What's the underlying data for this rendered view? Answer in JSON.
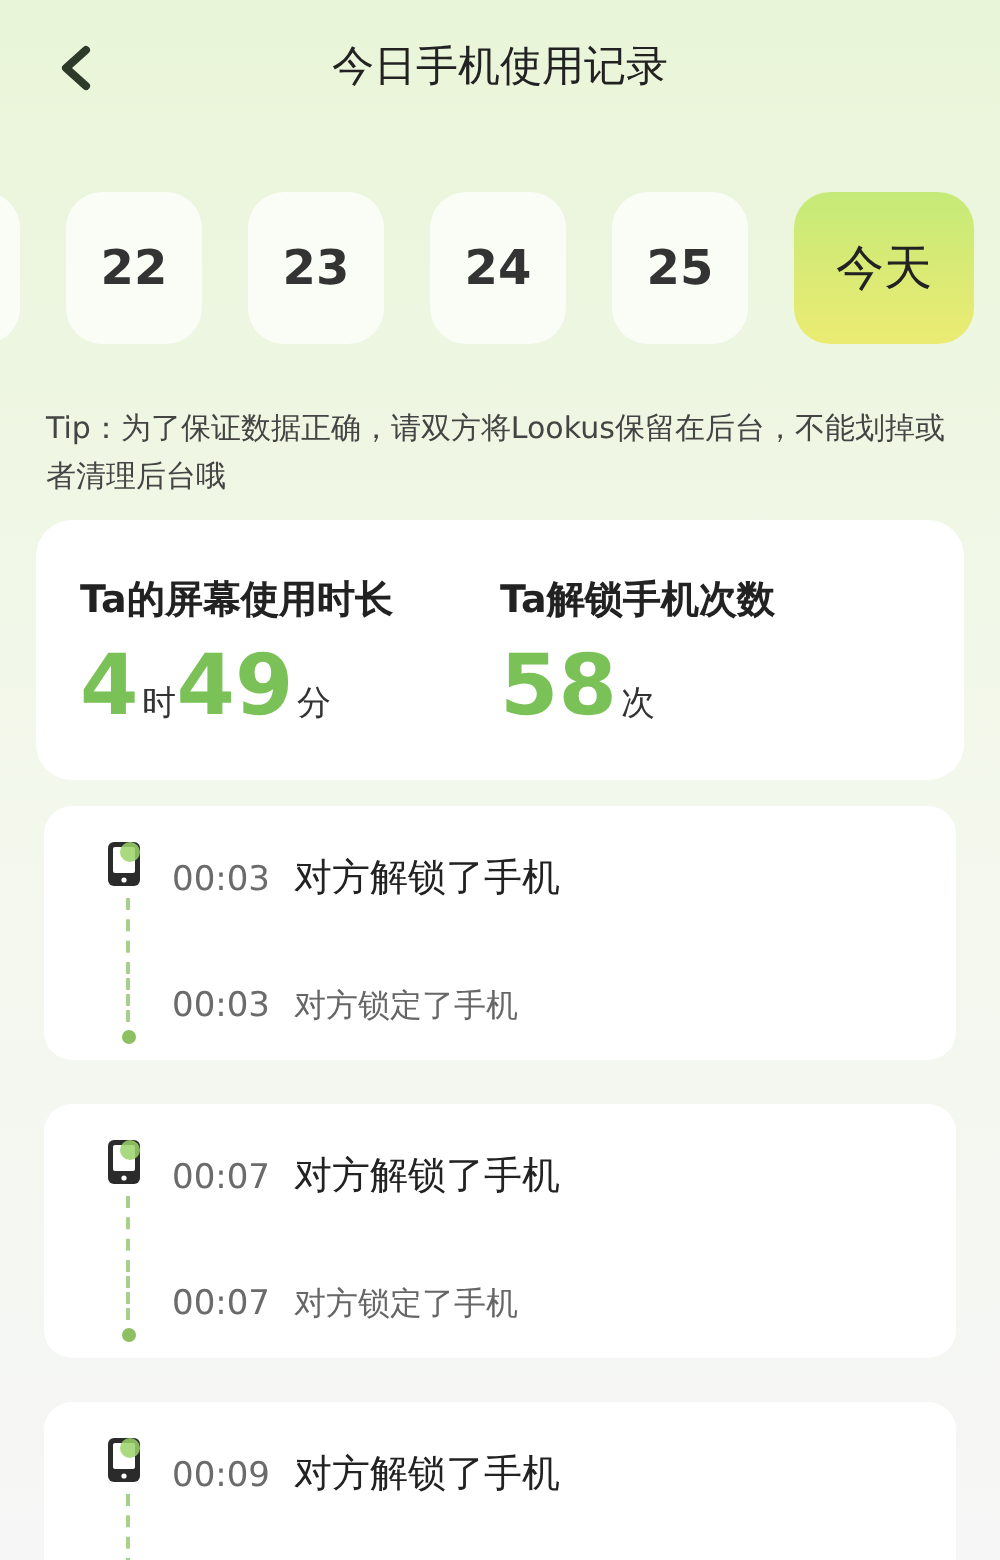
{
  "header": {
    "title": "今日手机使用记录"
  },
  "dates": [
    {
      "label": "22",
      "selected": false
    },
    {
      "label": "23",
      "selected": false
    },
    {
      "label": "24",
      "selected": false
    },
    {
      "label": "25",
      "selected": false
    },
    {
      "label": "今天",
      "selected": true
    }
  ],
  "tip": "Tip：为了保证数据正确，请双方将Lookus保留在后台，不能划掉或者清理后台哦",
  "stats": [
    {
      "label": "Ta的屏幕使用时长",
      "parts": [
        {
          "kind": "number",
          "text": "4"
        },
        {
          "kind": "unit",
          "text": "时"
        },
        {
          "kind": "number",
          "text": "49"
        },
        {
          "kind": "unit",
          "text": "分"
        }
      ]
    },
    {
      "label": "Ta解锁手机次数",
      "parts": [
        {
          "kind": "number",
          "text": "58"
        },
        {
          "kind": "unit",
          "text": "次"
        }
      ]
    }
  ],
  "records": [
    {
      "events": [
        {
          "kind": "unlock",
          "time": "00:03",
          "text": "对方解锁了手机"
        },
        {
          "kind": "lock",
          "time": "00:03",
          "text": "对方锁定了手机"
        }
      ]
    },
    {
      "events": [
        {
          "kind": "unlock",
          "time": "00:07",
          "text": "对方解锁了手机"
        },
        {
          "kind": "lock",
          "time": "00:07",
          "text": "对方锁定了手机"
        }
      ]
    },
    {
      "events": [
        {
          "kind": "unlock",
          "time": "00:09",
          "text": "对方解锁了手机"
        }
      ]
    }
  ]
}
